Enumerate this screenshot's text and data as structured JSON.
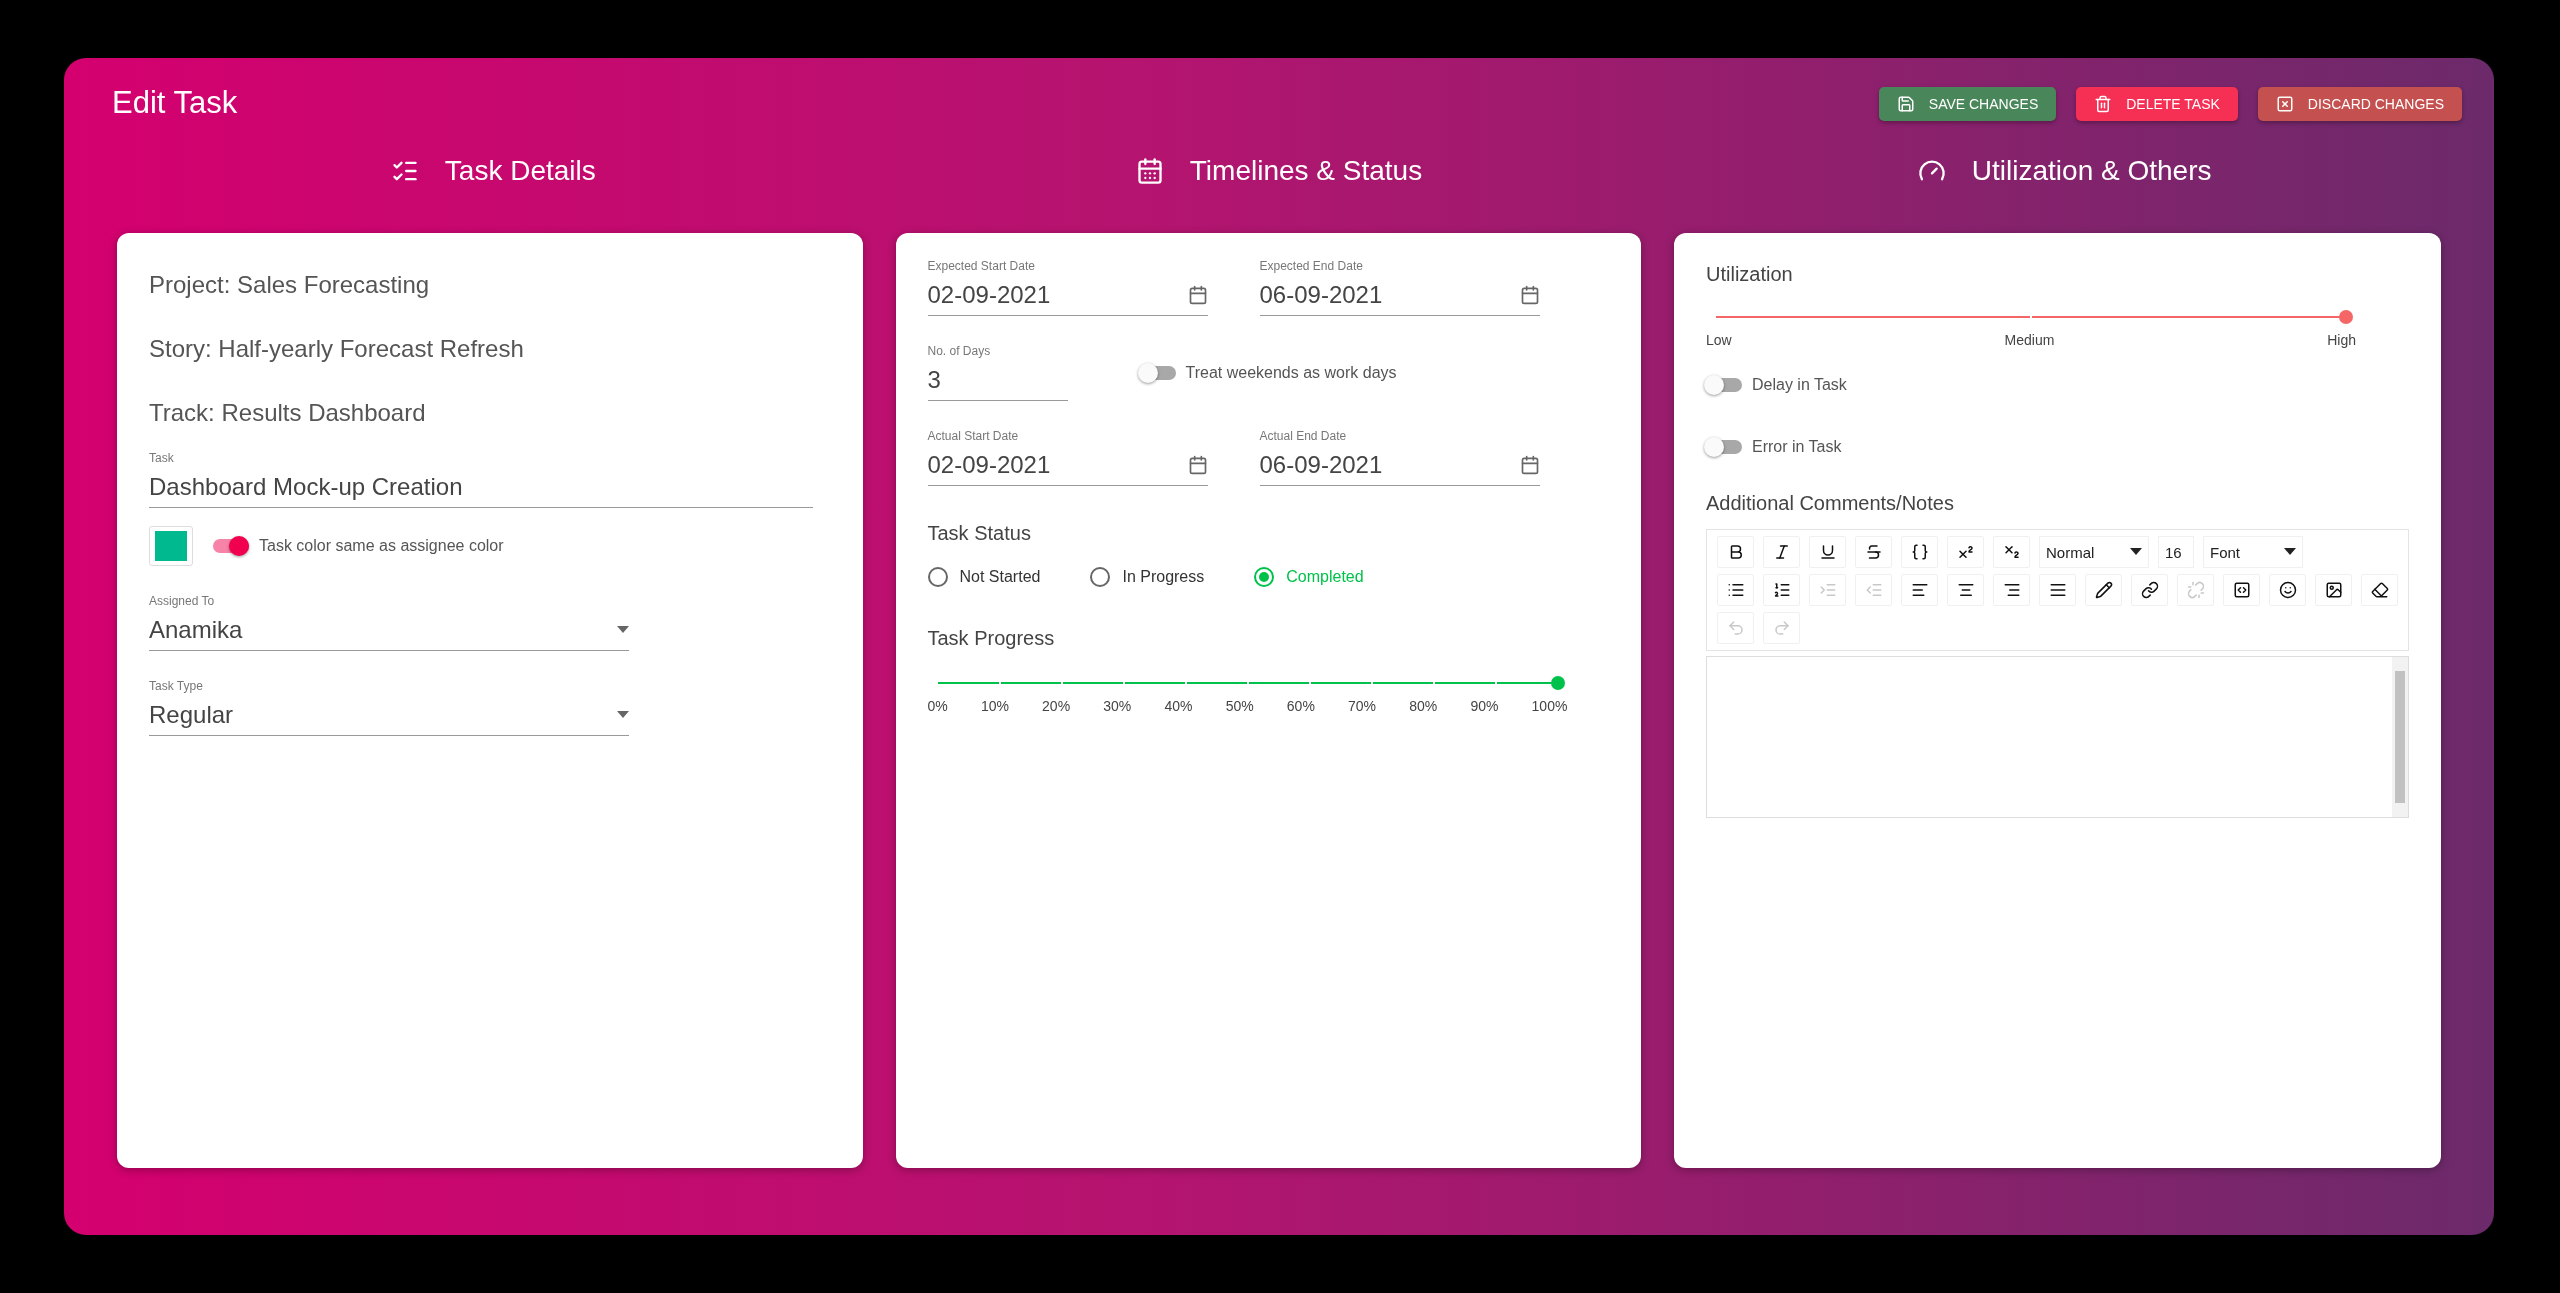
{
  "header": {
    "title": "Edit Task",
    "buttons": [
      {
        "label": "SAVE CHANGES",
        "kind": "save"
      },
      {
        "label": "DELETE TASK",
        "kind": "delete"
      },
      {
        "label": "DISCARD CHANGES",
        "kind": "discard"
      }
    ]
  },
  "sections": [
    {
      "title": "Task Details",
      "kind": "checklist"
    },
    {
      "title": "Timelines & Status",
      "kind": "calendar"
    },
    {
      "title": "Utilization & Others",
      "kind": "gauge"
    }
  ],
  "details": {
    "lines": [
      "Project: Sales Forecasting",
      "Story: Half-yearly Forecast Refresh",
      "Track: Results Dashboard"
    ],
    "task": {
      "label": "Task",
      "value": "Dashboard Mock-up Creation"
    },
    "color_toggle": {
      "label": "Task color same as assignee color",
      "on": true
    },
    "assigned_to": {
      "label": "Assigned To",
      "value": "Anamika"
    },
    "task_type": {
      "label": "Task Type",
      "value": "Regular"
    }
  },
  "timelines": {
    "expected_start": {
      "label": "Expected Start Date",
      "value": "02-09-2021"
    },
    "expected_end": {
      "label": "Expected End Date",
      "value": "06-09-2021"
    },
    "days": {
      "label": "No. of Days",
      "value": "3"
    },
    "weekends_toggle": {
      "label": "Treat weekends as work days",
      "on": false
    },
    "actual_start": {
      "label": "Actual Start Date",
      "value": "02-09-2021"
    },
    "actual_end": {
      "label": "Actual End Date",
      "value": "06-09-2021"
    },
    "status": {
      "title": "Task Status",
      "options": [
        {
          "label": "Not Started",
          "selected": false
        },
        {
          "label": "In Progress",
          "selected": false
        },
        {
          "label": "Completed",
          "selected": true
        }
      ]
    },
    "progress": {
      "title": "Task Progress",
      "level": 1,
      "marks": [
        "0%",
        "10%",
        "20%",
        "30%",
        "40%",
        "50%",
        "60%",
        "70%",
        "80%",
        "90%",
        "100%"
      ]
    }
  },
  "utilization": {
    "title": "Utilization",
    "level": 1,
    "marks": [
      "Low",
      "Medium",
      "High"
    ],
    "toggles": [
      {
        "label": "Delay in Task",
        "on": false
      },
      {
        "label": "Error in Task",
        "on": false
      }
    ],
    "comments": {
      "title": "Additional Comments/Notes",
      "toolbar_rows": [
        [
          {
            "kind": "bold",
            "disabled": false
          },
          {
            "kind": "italic",
            "disabled": false
          },
          {
            "kind": "underline",
            "disabled": false
          },
          {
            "kind": "strike",
            "disabled": false
          },
          {
            "kind": "code",
            "disabled": false
          },
          {
            "kind": "superscript",
            "disabled": false
          },
          {
            "kind": "subscript",
            "disabled": false
          },
          {
            "kind": "dropdown",
            "value": "Normal"
          },
          {
            "kind": "dropdown",
            "value": "16"
          },
          {
            "kind": "dropdown",
            "value": "Font"
          }
        ],
        [
          {
            "kind": "bullets",
            "disabled": false
          },
          {
            "kind": "numbers",
            "disabled": false
          },
          {
            "kind": "indent",
            "disabled": true
          },
          {
            "kind": "outdent",
            "disabled": true
          },
          {
            "kind": "left",
            "disabled": false
          },
          {
            "kind": "center",
            "disabled": false
          },
          {
            "kind": "right",
            "disabled": false
          },
          {
            "kind": "justify",
            "disabled": false
          },
          {
            "kind": "color",
            "disabled": false
          },
          {
            "kind": "link",
            "disabled": false
          },
          {
            "kind": "unlink",
            "disabled": true
          },
          {
            "kind": "embed",
            "disabled": false
          },
          {
            "kind": "emoji",
            "disabled": false
          },
          {
            "kind": "image",
            "disabled": false
          },
          {
            "kind": "eraser",
            "disabled": false
          }
        ],
        [
          {
            "kind": "undo",
            "disabled": true
          },
          {
            "kind": "redo",
            "disabled": true
          }
        ]
      ]
    }
  }
}
